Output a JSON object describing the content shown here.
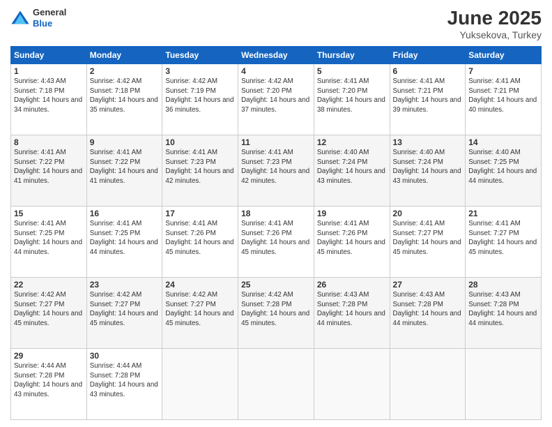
{
  "header": {
    "logo_general": "General",
    "logo_blue": "Blue",
    "month_title": "June 2025",
    "location": "Yuksekova, Turkey"
  },
  "weekdays": [
    "Sunday",
    "Monday",
    "Tuesday",
    "Wednesday",
    "Thursday",
    "Friday",
    "Saturday"
  ],
  "weeks": [
    [
      {
        "day": "1",
        "sunrise": "4:43 AM",
        "sunset": "7:18 PM",
        "daylight": "14 hours and 34 minutes."
      },
      {
        "day": "2",
        "sunrise": "4:42 AM",
        "sunset": "7:18 PM",
        "daylight": "14 hours and 35 minutes."
      },
      {
        "day": "3",
        "sunrise": "4:42 AM",
        "sunset": "7:19 PM",
        "daylight": "14 hours and 36 minutes."
      },
      {
        "day": "4",
        "sunrise": "4:42 AM",
        "sunset": "7:20 PM",
        "daylight": "14 hours and 37 minutes."
      },
      {
        "day": "5",
        "sunrise": "4:41 AM",
        "sunset": "7:20 PM",
        "daylight": "14 hours and 38 minutes."
      },
      {
        "day": "6",
        "sunrise": "4:41 AM",
        "sunset": "7:21 PM",
        "daylight": "14 hours and 39 minutes."
      },
      {
        "day": "7",
        "sunrise": "4:41 AM",
        "sunset": "7:21 PM",
        "daylight": "14 hours and 40 minutes."
      }
    ],
    [
      {
        "day": "8",
        "sunrise": "4:41 AM",
        "sunset": "7:22 PM",
        "daylight": "14 hours and 41 minutes."
      },
      {
        "day": "9",
        "sunrise": "4:41 AM",
        "sunset": "7:22 PM",
        "daylight": "14 hours and 41 minutes."
      },
      {
        "day": "10",
        "sunrise": "4:41 AM",
        "sunset": "7:23 PM",
        "daylight": "14 hours and 42 minutes."
      },
      {
        "day": "11",
        "sunrise": "4:41 AM",
        "sunset": "7:23 PM",
        "daylight": "14 hours and 42 minutes."
      },
      {
        "day": "12",
        "sunrise": "4:40 AM",
        "sunset": "7:24 PM",
        "daylight": "14 hours and 43 minutes."
      },
      {
        "day": "13",
        "sunrise": "4:40 AM",
        "sunset": "7:24 PM",
        "daylight": "14 hours and 43 minutes."
      },
      {
        "day": "14",
        "sunrise": "4:40 AM",
        "sunset": "7:25 PM",
        "daylight": "14 hours and 44 minutes."
      }
    ],
    [
      {
        "day": "15",
        "sunrise": "4:41 AM",
        "sunset": "7:25 PM",
        "daylight": "14 hours and 44 minutes."
      },
      {
        "day": "16",
        "sunrise": "4:41 AM",
        "sunset": "7:25 PM",
        "daylight": "14 hours and 44 minutes."
      },
      {
        "day": "17",
        "sunrise": "4:41 AM",
        "sunset": "7:26 PM",
        "daylight": "14 hours and 45 minutes."
      },
      {
        "day": "18",
        "sunrise": "4:41 AM",
        "sunset": "7:26 PM",
        "daylight": "14 hours and 45 minutes."
      },
      {
        "day": "19",
        "sunrise": "4:41 AM",
        "sunset": "7:26 PM",
        "daylight": "14 hours and 45 minutes."
      },
      {
        "day": "20",
        "sunrise": "4:41 AM",
        "sunset": "7:27 PM",
        "daylight": "14 hours and 45 minutes."
      },
      {
        "day": "21",
        "sunrise": "4:41 AM",
        "sunset": "7:27 PM",
        "daylight": "14 hours and 45 minutes."
      }
    ],
    [
      {
        "day": "22",
        "sunrise": "4:42 AM",
        "sunset": "7:27 PM",
        "daylight": "14 hours and 45 minutes."
      },
      {
        "day": "23",
        "sunrise": "4:42 AM",
        "sunset": "7:27 PM",
        "daylight": "14 hours and 45 minutes."
      },
      {
        "day": "24",
        "sunrise": "4:42 AM",
        "sunset": "7:27 PM",
        "daylight": "14 hours and 45 minutes."
      },
      {
        "day": "25",
        "sunrise": "4:42 AM",
        "sunset": "7:28 PM",
        "daylight": "14 hours and 45 minutes."
      },
      {
        "day": "26",
        "sunrise": "4:43 AM",
        "sunset": "7:28 PM",
        "daylight": "14 hours and 44 minutes."
      },
      {
        "day": "27",
        "sunrise": "4:43 AM",
        "sunset": "7:28 PM",
        "daylight": "14 hours and 44 minutes."
      },
      {
        "day": "28",
        "sunrise": "4:43 AM",
        "sunset": "7:28 PM",
        "daylight": "14 hours and 44 minutes."
      }
    ],
    [
      {
        "day": "29",
        "sunrise": "4:44 AM",
        "sunset": "7:28 PM",
        "daylight": "14 hours and 43 minutes."
      },
      {
        "day": "30",
        "sunrise": "4:44 AM",
        "sunset": "7:28 PM",
        "daylight": "14 hours and 43 minutes."
      },
      null,
      null,
      null,
      null,
      null
    ]
  ]
}
